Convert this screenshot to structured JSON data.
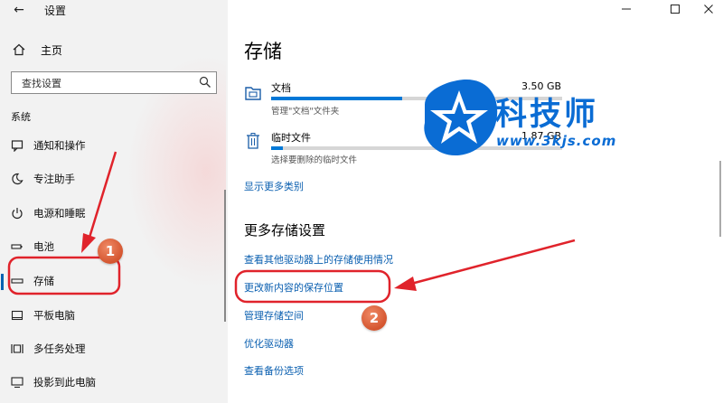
{
  "window": {
    "title": "设置",
    "back_icon": "back-arrow-icon",
    "controls": [
      "minimize-icon",
      "maximize-icon",
      "close-icon"
    ]
  },
  "sidebar": {
    "home_label": "主页",
    "search_placeholder": "查找设置",
    "section_label": "系统",
    "items": [
      {
        "label": "通知和操作",
        "icon": "notification-icon"
      },
      {
        "label": "专注助手",
        "icon": "moon-icon"
      },
      {
        "label": "电源和睡眠",
        "icon": "power-icon"
      },
      {
        "label": "电池",
        "icon": "battery-icon"
      },
      {
        "label": "存储",
        "icon": "storage-icon",
        "selected": true
      },
      {
        "label": "平板电脑",
        "icon": "tablet-icon"
      },
      {
        "label": "多任务处理",
        "icon": "multitask-icon"
      },
      {
        "label": "投影到此电脑",
        "icon": "project-icon"
      }
    ]
  },
  "main": {
    "title": "存储",
    "categories": [
      {
        "name": "文档",
        "size": "3.50 GB",
        "desc": "管理\"文档\"文件夹",
        "icon": "documents-folder-icon",
        "fill": 0.45
      },
      {
        "name": "临时文件",
        "size": "1.87 GB",
        "desc": "选择要删除的临时文件",
        "icon": "trash-icon",
        "fill": 0.04
      }
    ],
    "show_more": "显示更多类别",
    "more_heading": "更多存储设置",
    "links": [
      "查看其他驱动器上的存储使用情况",
      "更改新内容的保存位置",
      "管理存储空间",
      "优化驱动器",
      "查看备份选项"
    ]
  },
  "watermark": {
    "name": "科技师",
    "url": "www.3kjs.com"
  },
  "annotations": {
    "badge_1": "1",
    "badge_2": "2",
    "color": "#e0232b"
  }
}
